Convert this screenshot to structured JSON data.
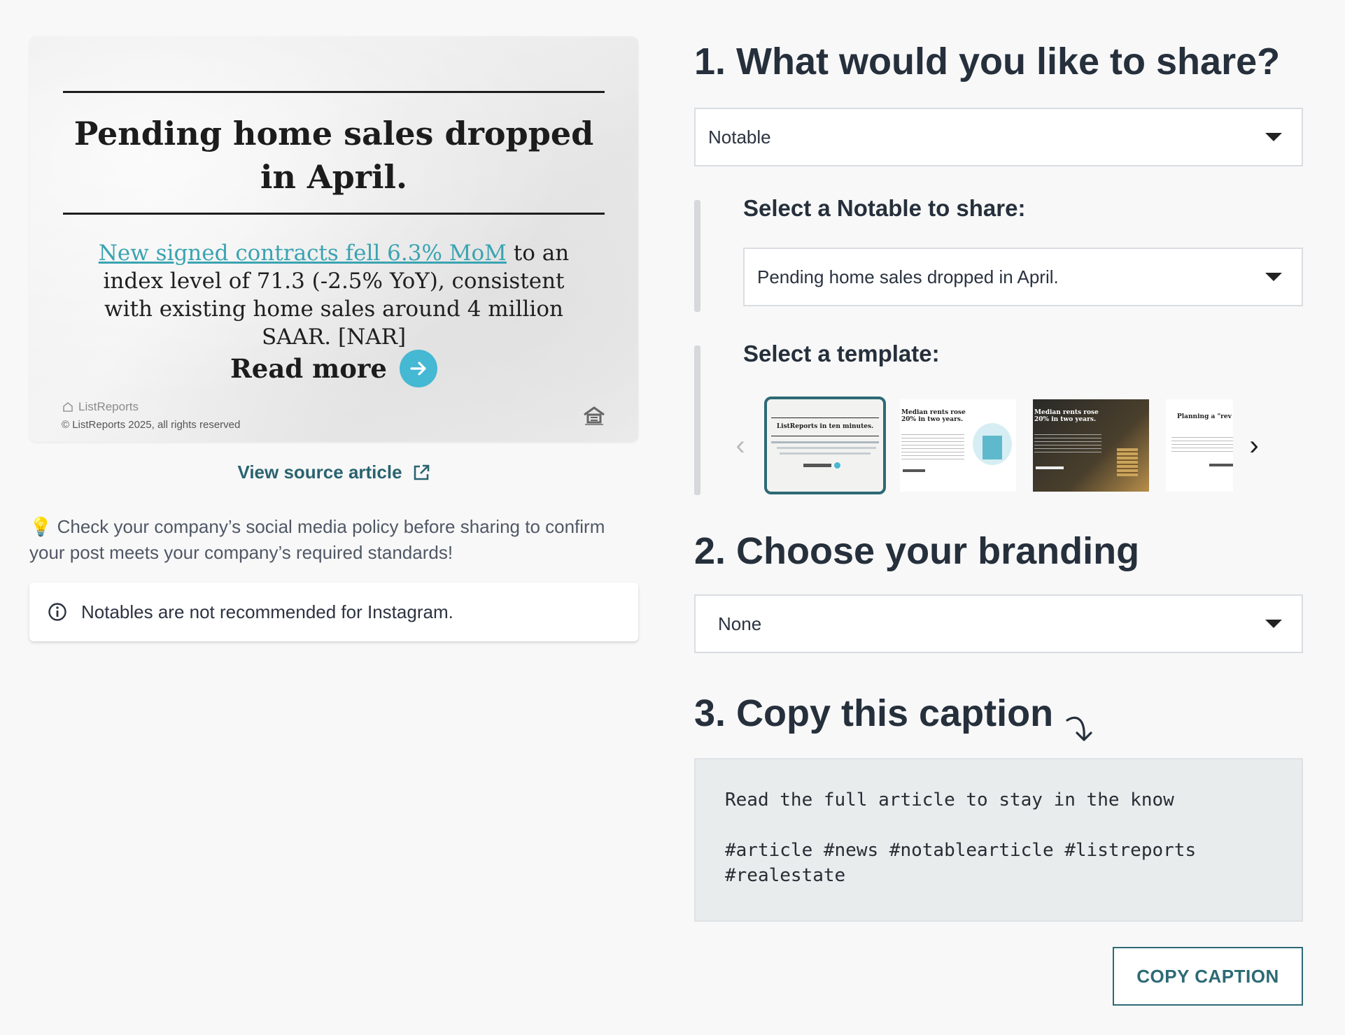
{
  "preview": {
    "headline": "Pending home sales dropped in April.",
    "body_link": "New signed contracts fell 6.3% MoM",
    "body_rest": " to an index level of 71.3 (-2.5% YoY), consistent with existing home sales around 4 million SAAR. [NAR]",
    "read_more": "Read more",
    "brand": "ListReports",
    "copyright": "© ListReports 2025, all rights reserved"
  },
  "source_link": "View source article",
  "tip": "💡 Check your company’s social media policy before sharing to confirm your post meets your company’s required standards!",
  "notice": "Notables are not recommended for Instagram.",
  "step1": {
    "title": "1. What would you like to share?",
    "selected": "Notable",
    "notable_label": "Select a Notable to share:",
    "notable_selected": "Pending home sales dropped in April.",
    "template_label": "Select a template:",
    "templates": [
      {
        "title": "ListReports in ten minutes.",
        "selected": true
      },
      {
        "title": "Median rents rose 20% in two years.",
        "selected": false
      },
      {
        "title": "Median rents rose 20% in two years.",
        "selected": false
      },
      {
        "title": "Planning a \"rev to Ha",
        "selected": false
      }
    ]
  },
  "step2": {
    "title": "2. Choose your branding",
    "selected": "None"
  },
  "step3": {
    "title": "3. Copy this caption",
    "caption": "Read the full article to stay in the know\n\n#article #news #notablearticle #listreports\n#realestate",
    "button": "COPY CAPTION"
  },
  "colors": {
    "accent": "#2d6a75",
    "link": "#3aa3b1",
    "arrow_circle": "#45b8d3"
  }
}
